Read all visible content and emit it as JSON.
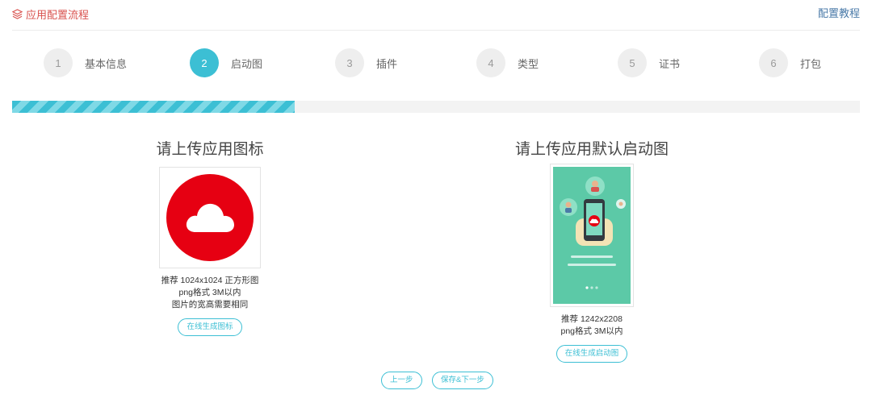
{
  "header": {
    "title": "应用配置流程",
    "tutorial_link": "配置教程"
  },
  "steps": [
    {
      "number": "1",
      "label": "基本信息",
      "active": false
    },
    {
      "number": "2",
      "label": "启动图",
      "active": true
    },
    {
      "number": "3",
      "label": "插件",
      "active": false
    },
    {
      "number": "4",
      "label": "类型",
      "active": false
    },
    {
      "number": "5",
      "label": "证书",
      "active": false
    },
    {
      "number": "6",
      "label": "打包",
      "active": false
    }
  ],
  "progress": {
    "fraction": 0.333
  },
  "icon_upload": {
    "title": "请上传应用图标",
    "hint_line1": "推荐 1024x1024 正方形图",
    "hint_line2": "png格式 3M以内",
    "hint_line3": "图片的宽高需要相同",
    "generate_button": "在线生成图标"
  },
  "splash_upload": {
    "title": "请上传应用默认启动图",
    "hint_line1": "推荐 1242x2208",
    "hint_line2": "png格式 3M以内",
    "generate_button": "在线生成启动图"
  },
  "actions": {
    "prev_button": "上一步",
    "save_next_button": "保存&下一步"
  },
  "colors": {
    "accent": "#3cbfd4",
    "title_red": "#d9534f",
    "icon_red": "#e60012",
    "splash_green": "#5cc9a7"
  },
  "icons": {
    "header": "layers-icon",
    "app_icon": "cloud-icon"
  }
}
